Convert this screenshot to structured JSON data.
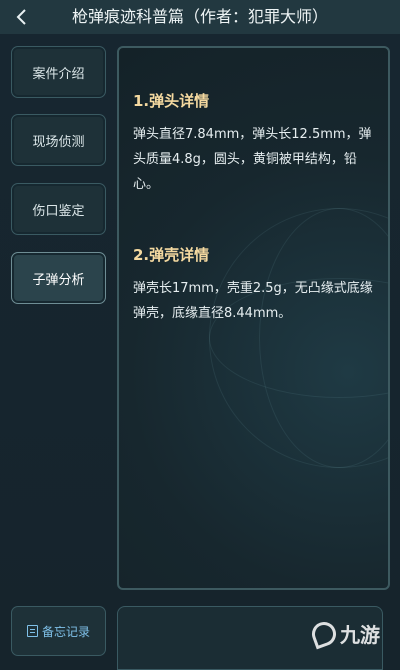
{
  "header": {
    "title": "枪弹痕迹科普篇（作者：犯罪大师）",
    "back_icon": "chevron-left-icon"
  },
  "sidebar": {
    "items": [
      {
        "label": "案件介绍",
        "active": false
      },
      {
        "label": "现场侦测",
        "active": false
      },
      {
        "label": "伤口鉴定",
        "active": false
      },
      {
        "label": "子弹分析",
        "active": true
      }
    ],
    "memo_label": "备忘记录"
  },
  "content": {
    "sections": [
      {
        "title": "1.弹头详情",
        "body": "弹头直径7.84mm，弹头长12.5mm，弹头质量4.8g，圆头，黄铜被甲结构，铅心。"
      },
      {
        "title": "2.弹壳详情",
        "body": "弹壳长17mm，壳重2.5g，无凸缘式底缘弹壳，底缘直径8.44mm。"
      }
    ]
  },
  "watermark": {
    "text": "九游"
  },
  "colors": {
    "accent_title": "#f4d9a0",
    "memo_blue": "#7fc0e8",
    "panel_border": "#3d5a60"
  }
}
